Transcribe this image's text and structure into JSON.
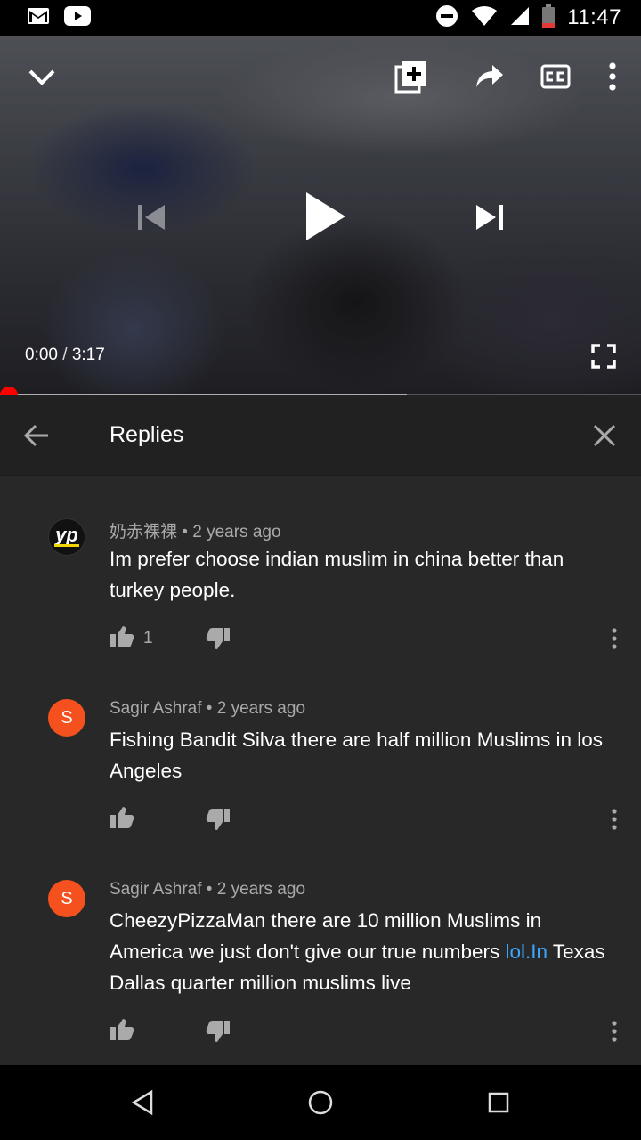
{
  "status_bar": {
    "time": "11:47",
    "icons": [
      "gmail-icon",
      "youtube-icon",
      "do-not-disturb-icon",
      "wifi-icon",
      "signal-icon",
      "battery-icon"
    ]
  },
  "video": {
    "current_time": "0:00",
    "separator": "/",
    "duration": "3:17",
    "played_fraction": 0.0,
    "buffered_fraction": 0.635,
    "controls": [
      "minimize-icon",
      "add-to-playlist-icon",
      "share-icon",
      "captions-icon",
      "more-options-icon",
      "previous-icon",
      "play-icon",
      "next-icon",
      "fullscreen-icon"
    ]
  },
  "replies_header": {
    "title": "Replies"
  },
  "comments": [
    {
      "avatar_text": "yp",
      "author": "奶赤裸裸",
      "time": "2 years ago",
      "text": "Im prefer choose indian muslim in china better than turkey people.",
      "likes": "1"
    },
    {
      "avatar_text": "S",
      "author": "Sagir Ashraf",
      "time": "2 years ago",
      "text": "Fishing Bandit Silva there are half million Muslims in los Angeles",
      "likes": ""
    },
    {
      "avatar_text": "S",
      "author": "Sagir Ashraf",
      "time": "2 years ago",
      "text_before_link": "CheezyPizzaMan there are 10 million Muslims in America we just  don't give our true numbers ",
      "link_text": "lol.In",
      "text_after_link": " Texas Dallas quarter million muslims live",
      "likes": ""
    }
  ],
  "colors": {
    "accent_red": "#ff0000",
    "link_blue": "#3ea6ff",
    "avatar_orange": "#f4511e",
    "panel_bg": "#282828",
    "header_bg": "#212121"
  }
}
